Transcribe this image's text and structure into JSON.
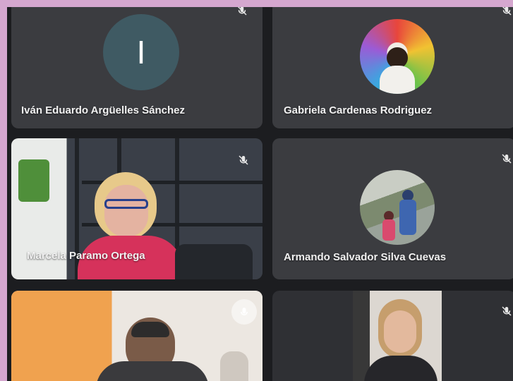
{
  "participants": [
    {
      "name": "Iván Eduardo Argüelles Sánchez",
      "initial": "I",
      "muted": true
    },
    {
      "name": "Gabriela Cardenas Rodriguez",
      "muted": true
    },
    {
      "name": "Marcela Paramo Ortega",
      "muted": true
    },
    {
      "name": "Armando Salvador Silva Cuevas",
      "muted": true
    },
    {
      "name": "",
      "muted": false
    },
    {
      "name": "",
      "muted": true
    }
  ],
  "icons": {
    "mic_off": "mic-off-icon",
    "pin": "pin-icon"
  },
  "colors": {
    "frame": "#d5a7cf",
    "background": "#1c1d20",
    "tile": "#3b3c40",
    "avatar": "#3f5a63"
  }
}
